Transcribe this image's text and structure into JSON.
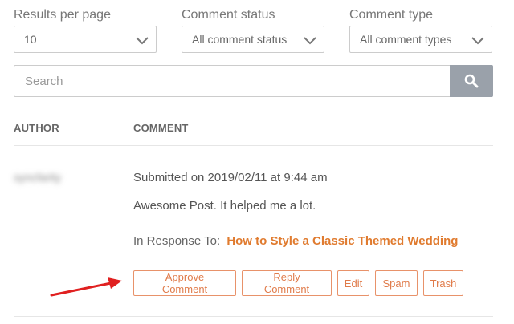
{
  "filters": {
    "results_per_page": {
      "label": "Results per page",
      "value": "10"
    },
    "comment_status": {
      "label": "Comment status",
      "value": "All comment status"
    },
    "comment_type": {
      "label": "Comment type",
      "value": "All comment types"
    }
  },
  "search": {
    "placeholder": "Search"
  },
  "table": {
    "headers": {
      "author": "AUTHOR",
      "comment": "COMMENT"
    },
    "rows": [
      {
        "author": "syncfarity",
        "submitted": "Submitted on 2019/02/11 at 9:44 am",
        "text": "Awesome Post. It helped me a lot.",
        "response_label": "In Response To:",
        "response_link": "How to Style a Classic Themed Wedding",
        "actions": {
          "approve": "Approve Comment",
          "reply": "Reply Comment",
          "edit": "Edit",
          "spam": "Spam",
          "trash": "Trash"
        }
      }
    ]
  },
  "colors": {
    "accent": "#e07b2f",
    "annotation_arrow": "#e02020",
    "search_button": "#9aa1aa"
  }
}
